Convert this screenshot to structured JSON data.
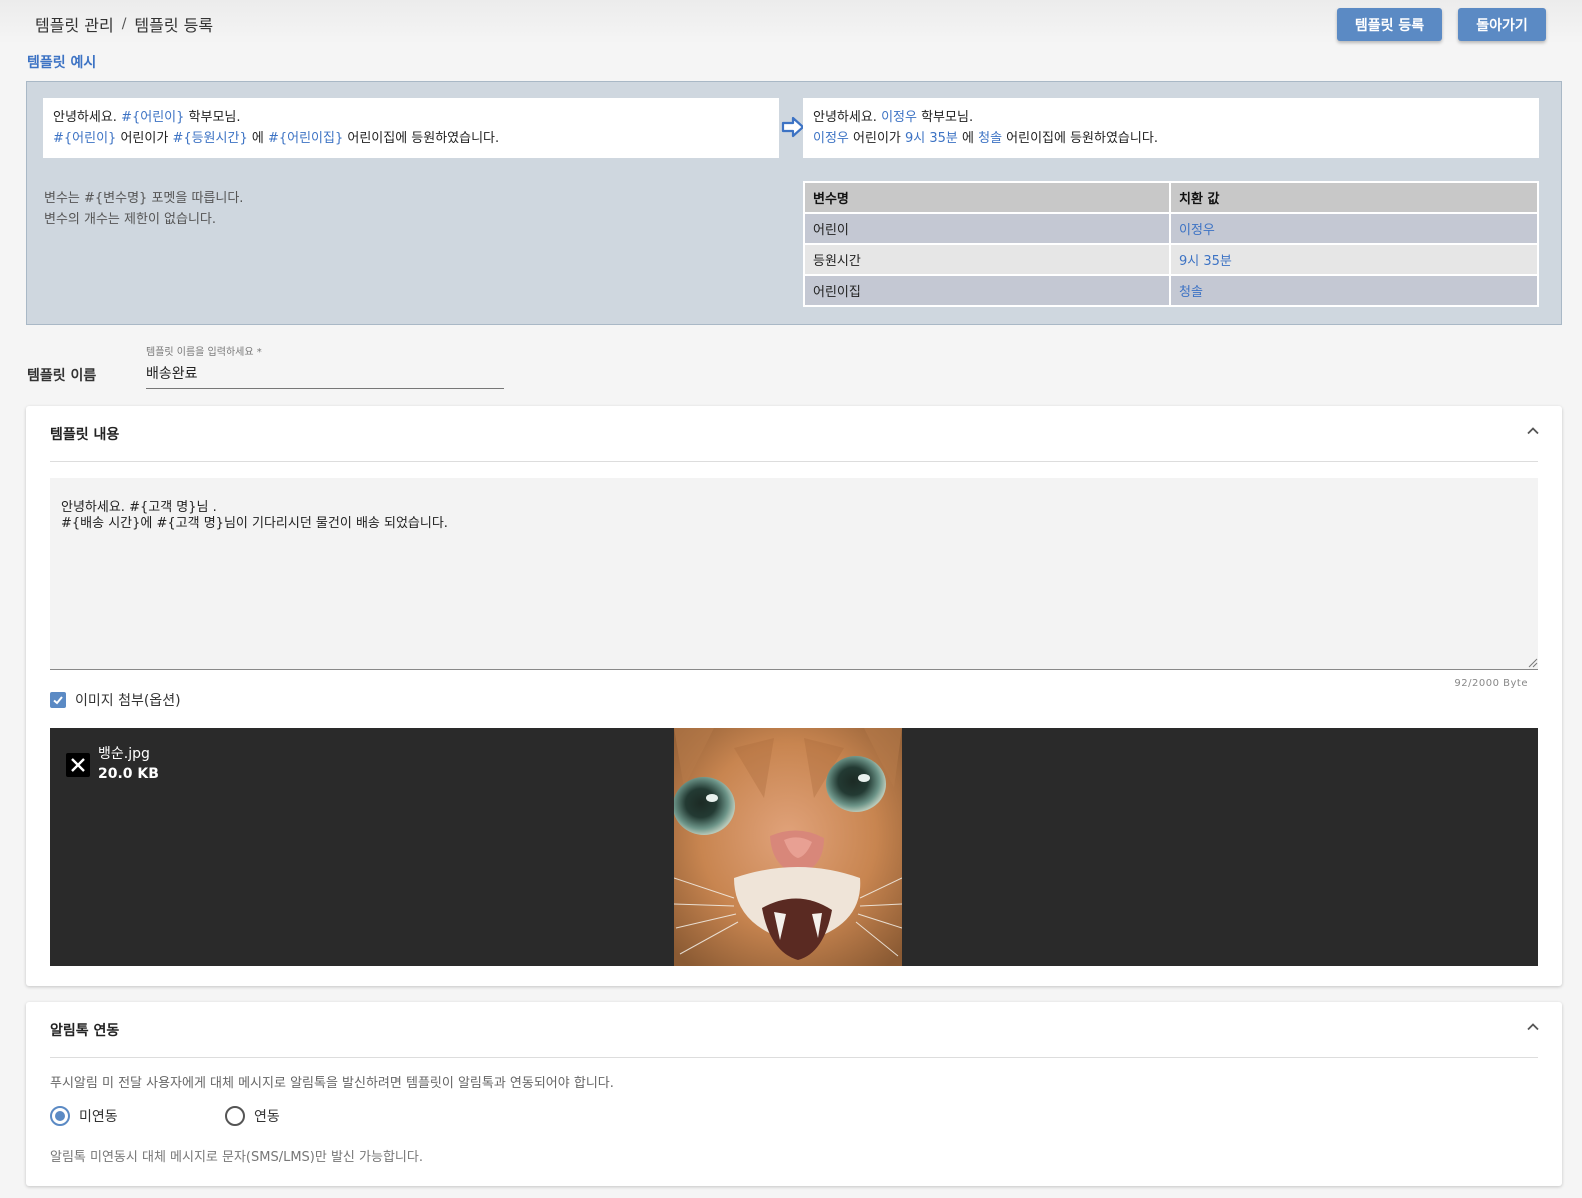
{
  "breadcrumb": {
    "parent": "템플릿 관리",
    "separator": "/",
    "current": "템플릿 등록"
  },
  "actions": {
    "register_label": "템플릿 등록",
    "back_label": "돌아가기"
  },
  "example": {
    "title": "템플릿 예시",
    "template": {
      "line1": {
        "p1": "안녕하세요. ",
        "v1": "#{어린이}",
        "p2": " 학부모님."
      },
      "line2": {
        "v1": "#{어린이}",
        "p1": " 어린이가 ",
        "v2": "#{등원시간}",
        "p2": " 에 ",
        "v3": "#{어린이집}",
        "p3": " 어린이집에 등원하였습니다."
      }
    },
    "result": {
      "line1": {
        "p1": "안녕하세요. ",
        "v1": "이정우",
        "p2": " 학부모님."
      },
      "line2": {
        "v1": "이정우",
        "p1": " 어린이가 ",
        "v2": "9시 35분",
        "p2": " 에 ",
        "v3": "청솔",
        "p3": " 어린이집에 등원하였습니다."
      }
    },
    "notes": [
      "변수는 #{변수명} 포멧을 따릅니다.",
      "변수의 개수는 제한이 없습니다."
    ],
    "table": {
      "headers": [
        "변수명",
        "치환 값"
      ],
      "rows": [
        {
          "name": "어린이",
          "value": "이정우"
        },
        {
          "name": "등원시간",
          "value": "9시 35분"
        },
        {
          "name": "어린이집",
          "value": "청솔"
        }
      ]
    }
  },
  "template_name": {
    "label": "템플릿 이름",
    "placeholder": "템플릿 이름을 입력하세요 *",
    "value": "배송완료"
  },
  "content": {
    "title": "템플릿 내용",
    "text": "안녕하세요. #{고객 명}님 .\n#{배송 시간}에 #{고객 명}님이 기다리시던 물건이 배송 되었습니다.",
    "counter": "92/2000 Byte",
    "attach_label": "이미지 첨부(옵션)",
    "attach_checked": true,
    "file": {
      "name": "뱅순.jpg",
      "size": "20.0 KB"
    }
  },
  "alimtalk": {
    "title": "알림톡 연동",
    "description": "푸시알림 미 전달 사용자에게 대체 메시지로 알림톡을 발신하려면 템플릿이 알림톡과 연동되어야 합니다.",
    "options": [
      "미연동",
      "연동"
    ],
    "selected": "미연동",
    "note": "알림톡 미연동시 대체 메시지로 문자(SMS/LMS)만 발신 가능합니다."
  },
  "colors": {
    "accent": "#5b8ac4",
    "link": "#3d73c4",
    "example_bg": "#cfd7df"
  }
}
